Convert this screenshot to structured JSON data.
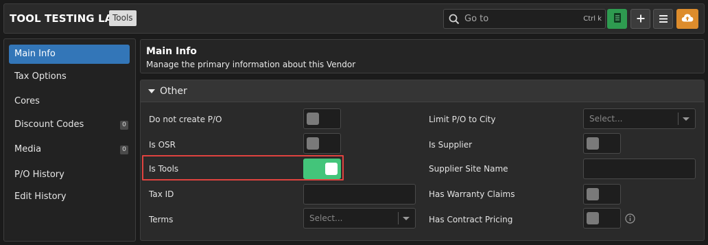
{
  "header": {
    "app_title": "TOOL TESTING LAB",
    "badge": "Tools",
    "goto_placeholder": "Go to",
    "goto_shortcut": "Ctrl k"
  },
  "sidebar": {
    "items": [
      {
        "label": "Main Info",
        "active": true
      },
      {
        "label": "Tax Options"
      },
      {
        "label": "Cores"
      },
      {
        "label": "Discount Codes",
        "count": "0"
      },
      {
        "label": "Media",
        "count": "0"
      },
      {
        "label": "P/O History"
      },
      {
        "label": "Edit History"
      }
    ]
  },
  "main": {
    "title": "Main Info",
    "subtitle": "Manage the primary information about this Vendor"
  },
  "section": {
    "title": "Other",
    "left_fields": {
      "do_not_create_po": {
        "label": "Do not create P/O",
        "value": false
      },
      "is_osr": {
        "label": "Is OSR",
        "value": false
      },
      "is_tools": {
        "label": "Is Tools",
        "value": true
      },
      "tax_id": {
        "label": "Tax ID",
        "value": ""
      },
      "terms": {
        "label": "Terms",
        "placeholder": "Select..."
      }
    },
    "right_fields": {
      "limit_po_to_city": {
        "label": "Limit P/O to City",
        "placeholder": "Select..."
      },
      "is_supplier": {
        "label": "Is Supplier",
        "value": false
      },
      "supplier_site_name": {
        "label": "Supplier Site Name",
        "value": ""
      },
      "has_warranty_claims": {
        "label": "Has Warranty Claims",
        "value": false
      },
      "has_contract_pricing": {
        "label": "Has Contract Pricing",
        "value": false
      }
    }
  },
  "colors": {
    "accent_blue": "#3376b8",
    "toggle_on": "#43c57a",
    "highlight_red": "#e0433f",
    "upload_orange": "#dd8c2c",
    "sheet_green": "#2e9b50"
  },
  "icons": [
    "search-icon",
    "spreadsheet-icon",
    "plus-icon",
    "menu-icon",
    "cloud-upload-icon",
    "caret-down-icon",
    "info-icon"
  ]
}
